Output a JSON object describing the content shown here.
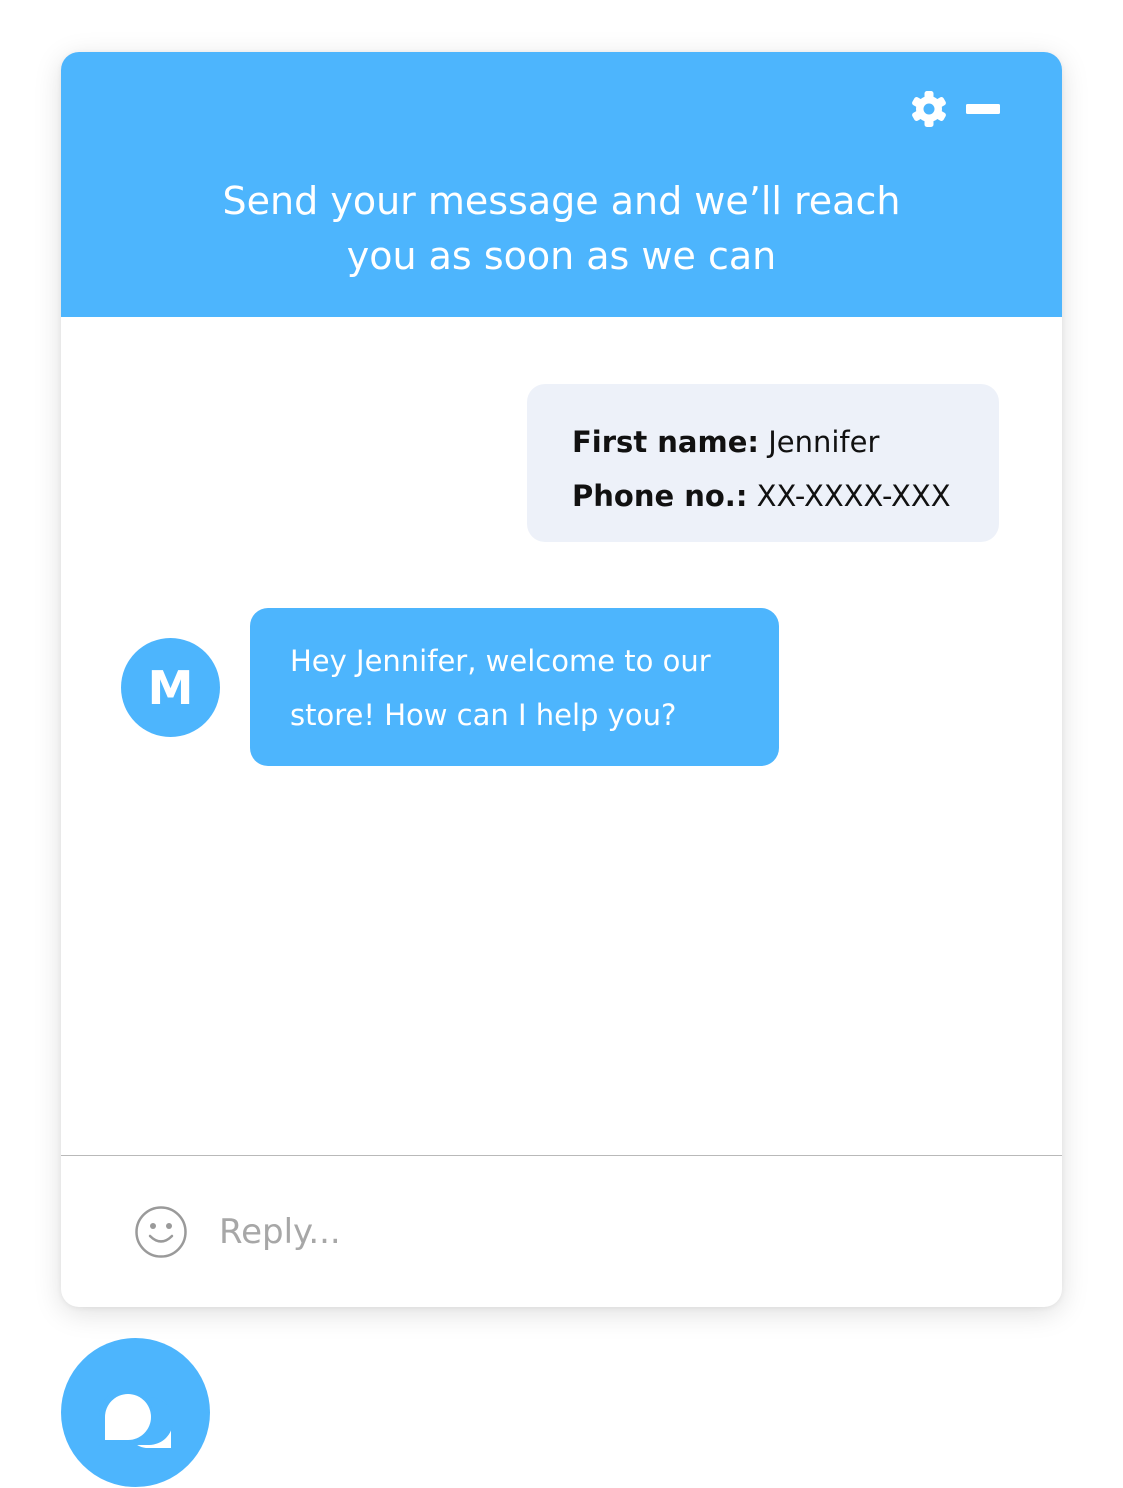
{
  "header": {
    "title": "Send your message and we’ll reach\nyou as soon as we can",
    "settings_icon": "gear-icon",
    "minimize_icon": "minimize-icon"
  },
  "messages": {
    "visitor": {
      "first_name_label": "First name:",
      "first_name_value": " Jennifer",
      "phone_label": "Phone no.:",
      "phone_value": " XX-XXXX-XXX"
    },
    "agent": {
      "avatar_initial": "M",
      "text": "Hey Jennifer, welcome to our store! How can I help you?"
    }
  },
  "composer": {
    "placeholder": "Reply...",
    "emoji_icon": "smiley-icon"
  },
  "launcher": {
    "icon": "chat-bubbles-icon"
  },
  "colors": {
    "accent": "#4db5fd",
    "visitor_bubble": "#edf1f9",
    "divider": "#b9b9b9",
    "placeholder": "#a7a7a7"
  }
}
